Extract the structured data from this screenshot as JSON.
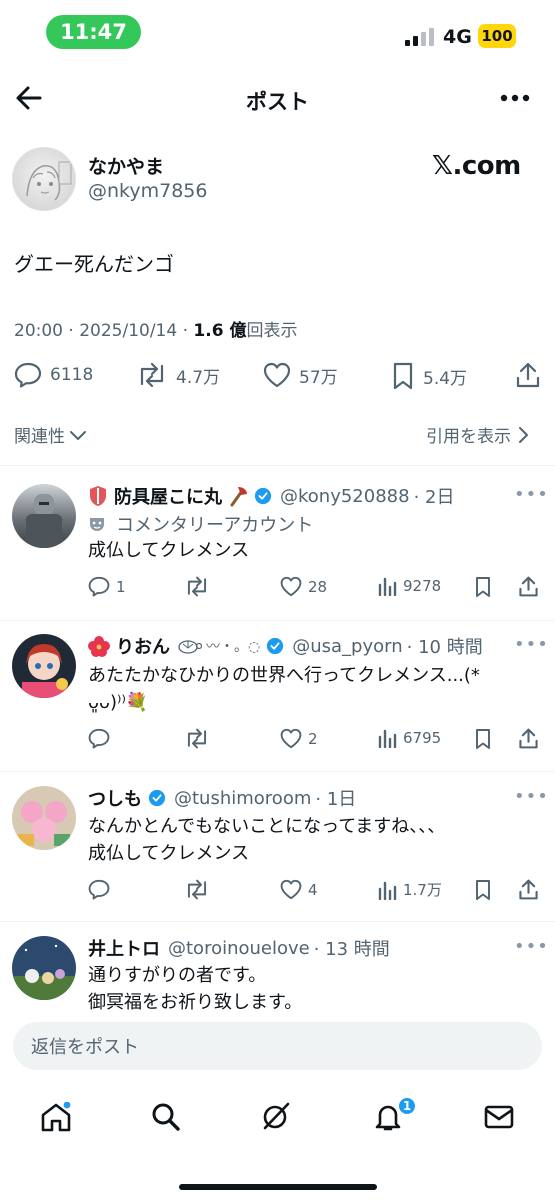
{
  "status_bar": {
    "time": "11:47",
    "network": "4G",
    "battery": "100"
  },
  "header": {
    "title": "ポスト"
  },
  "main_post": {
    "name": "なかやま",
    "handle": "@nkym7856",
    "brand": "𝕏.com",
    "text": "グエー死んだンゴ",
    "timestamp": "20:00 · 2025/10/14 · ",
    "views_number": "1.6 億",
    "views_label": "回表示",
    "stats": {
      "replies": "6118",
      "reposts": "4.7万",
      "likes": "57万",
      "bookmarks": "5.4万"
    },
    "relevance_label": "関連性",
    "quotes_label": "引用を表示"
  },
  "replies": [
    {
      "name": "防具屋こに丸",
      "handle": "@kony520888",
      "time": "· 2日",
      "sub_label": "コメンタリーアカウント",
      "text_lines": [
        "成仏してクレメンス"
      ],
      "stats": {
        "replies": "1",
        "reposts": "",
        "likes": "28",
        "views": "9278"
      }
    },
    {
      "name": "りおん",
      "name_decoration": "〰・。◌",
      "handle": "@usa_pyorn",
      "time": "· 10 時間",
      "text_lines": [
        "あたたかなひかりの世界へ行ってクレメンス...(*",
        "ᴗ͈ᴗ)⁾⁾💐"
      ],
      "stats": {
        "replies": "",
        "reposts": "",
        "likes": "2",
        "views": "6795"
      }
    },
    {
      "name": "つしも",
      "handle": "@tushimoroom",
      "time": "· 1日",
      "text_lines": [
        "なんかとんでもないことになってますね、、、",
        "成仏してクレメンス"
      ],
      "stats": {
        "replies": "",
        "reposts": "",
        "likes": "4",
        "views": "1.7万"
      }
    },
    {
      "name": "井上トロ",
      "handle": "@toroinouelove",
      "time": "· 13 時間",
      "text_lines": [
        "通りすがりの者です。",
        "御冥福をお祈り致します。"
      ]
    }
  ],
  "composer": {
    "placeholder": "返信をポスト"
  },
  "bottom_nav": {
    "notification_count": "1"
  },
  "colors": {
    "accent": "#1d9bf0",
    "secondary_text": "#536471",
    "status_pill": "#34c759",
    "battery": "#ffd60a"
  }
}
